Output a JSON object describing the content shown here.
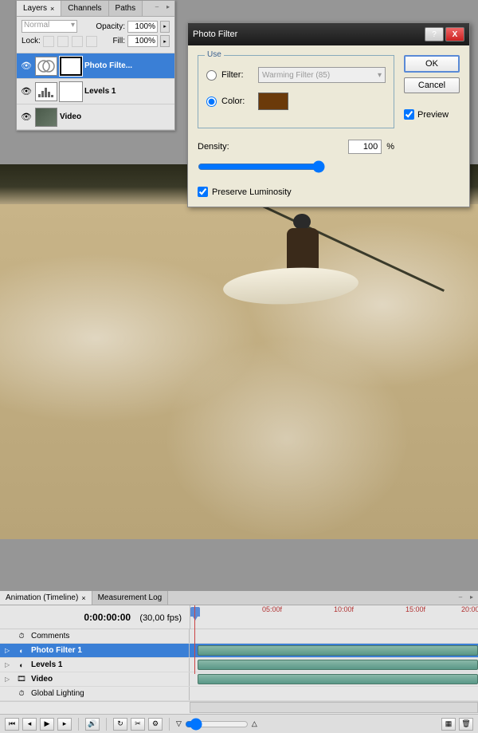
{
  "layers_panel": {
    "tabs": {
      "layers": "Layers",
      "channels": "Channels",
      "paths": "Paths"
    },
    "blend_mode": "Normal",
    "opacity_label": "Opacity:",
    "opacity_value": "100%",
    "lock_label": "Lock:",
    "fill_label": "Fill:",
    "fill_value": "100%",
    "layers": [
      {
        "name": "Photo Filte..."
      },
      {
        "name": "Levels 1"
      },
      {
        "name": "Video"
      }
    ]
  },
  "photo_filter_dialog": {
    "title": "Photo Filter",
    "use_legend": "Use",
    "filter_label": "Filter:",
    "color_label": "Color:",
    "filter_dropdown": "Warming Filter (85)",
    "color_hex": "#6b3a0a",
    "density_label": "Density:",
    "density_value": "100",
    "density_unit": "%",
    "preserve_label": "Preserve Luminosity",
    "ok": "OK",
    "cancel": "Cancel",
    "preview": "Preview",
    "selected_use": "color",
    "preserve_checked": true,
    "preview_checked": true
  },
  "animation_panel": {
    "tabs": {
      "anim": "Animation (Timeline)",
      "measure": "Measurement Log"
    },
    "timecode": "0:00:00:00",
    "fps": "(30,00 fps)",
    "ruler_marks": [
      "05:00f",
      "10:00f",
      "15:00f",
      "20:00"
    ],
    "tracks": {
      "comments": "Comments",
      "photofilter": "Photo Filter 1",
      "levels": "Levels 1",
      "video": "Video",
      "global": "Global Lighting"
    }
  }
}
